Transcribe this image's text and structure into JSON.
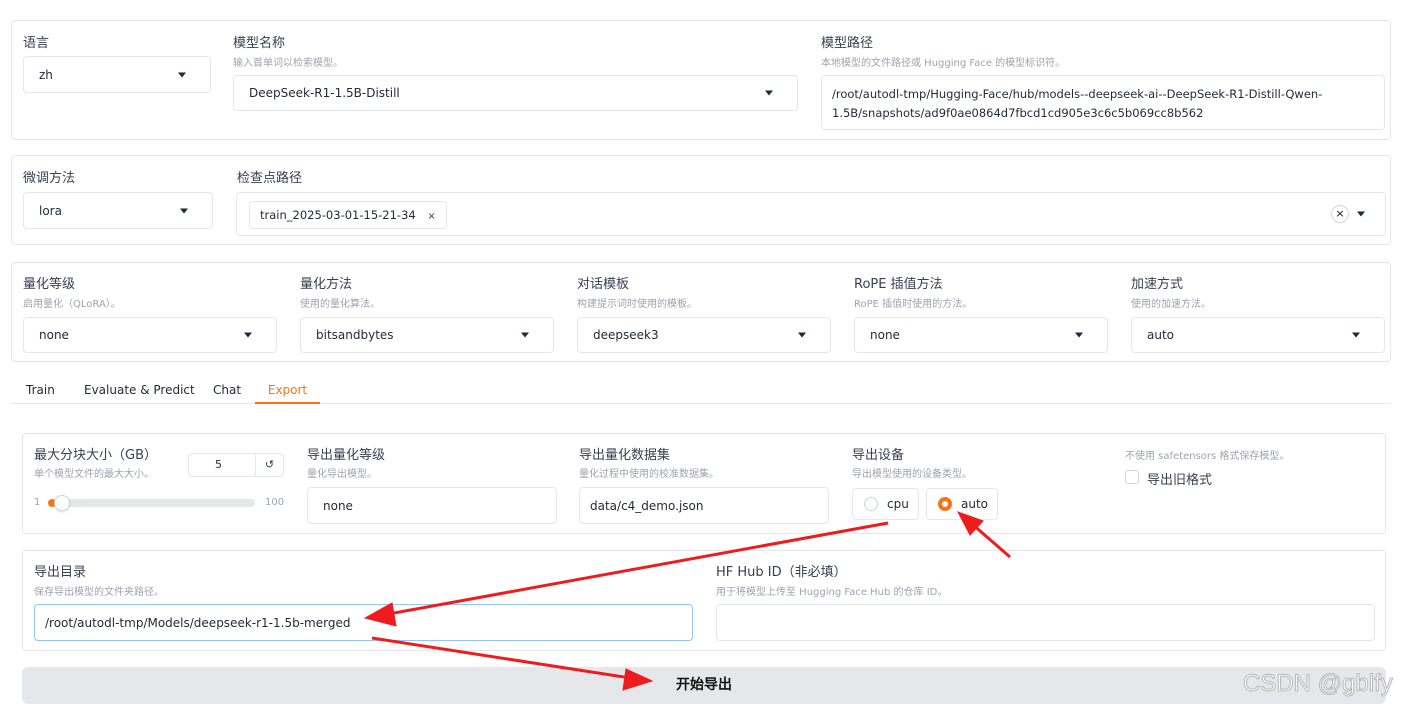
{
  "model_section": {
    "language": {
      "label": "语言",
      "value": "zh"
    },
    "model_name": {
      "label": "模型名称",
      "hint": "输入首单词以检索模型。",
      "value": "DeepSeek-R1-1.5B-Distill"
    },
    "model_path": {
      "label": "模型路径",
      "hint": "本地模型的文件路径或 Hugging Face 的模型标识符。",
      "value_line1": "/root/autodl-tmp/Hugging-Face/hub/models--deepseek-ai--DeepSeek-R1-Distill-Qwen-",
      "value_line2": "1.5B/snapshots/ad9f0ae0864d7fbcd1cd905e3c6c5b069cc8b562"
    }
  },
  "finetune_section": {
    "method": {
      "label": "微调方法",
      "value": "lora"
    },
    "checkpoint": {
      "label": "检查点路径",
      "tag": "train_2025-03-01-15-21-34",
      "tag_close": "×",
      "clear": "×"
    }
  },
  "advanced_section": {
    "quant_bit": {
      "label": "量化等级",
      "hint": "启用量化（QLoRA）。",
      "value": "none"
    },
    "quant_method": {
      "label": "量化方法",
      "hint": "使用的量化算法。",
      "value": "bitsandbytes"
    },
    "template": {
      "label": "对话模板",
      "hint": "构建提示词时使用的模板。",
      "value": "deepseek3"
    },
    "rope": {
      "label": "RoPE 插值方法",
      "hint": "RoPE 插值时使用的方法。",
      "value": "none"
    },
    "booster": {
      "label": "加速方式",
      "hint": "使用的加速方法。",
      "value": "auto"
    }
  },
  "tabs": [
    {
      "label": "Train",
      "active": false
    },
    {
      "label": "Evaluate & Predict",
      "active": false
    },
    {
      "label": "Chat",
      "active": false
    },
    {
      "label": "Export",
      "active": true
    }
  ],
  "export": {
    "shard_size": {
      "label": "最大分块大小（GB）",
      "hint": "单个模型文件的最大大小。",
      "value": "5",
      "reset": "↺",
      "min": "1",
      "max": "100",
      "level": 0.04
    },
    "quant_bit": {
      "label": "导出量化等级",
      "hint": "量化导出模型。",
      "value": "none"
    },
    "quant_dataset": {
      "label": "导出量化数据集",
      "hint": "量化过程中使用的校准数据集。",
      "value": "data/c4_demo.json"
    },
    "device": {
      "label": "导出设备",
      "hint": "导出模型使用的设备类型。",
      "options": [
        "cpu",
        "auto"
      ],
      "selected": "auto"
    },
    "legacy": {
      "hint": "不使用 safetensors 格式保存模型。",
      "label": "导出旧格式",
      "checked": false
    },
    "dir": {
      "label": "导出目录",
      "hint": "保存导出模型的文件夹路径。",
      "value": "/root/autodl-tmp/Models/deepseek-r1-1.5b-merged"
    },
    "hub": {
      "label": "HF Hub ID（非必填）",
      "hint": "用于将模型上传至 Hugging Face Hub 的仓库 ID。",
      "value": ""
    },
    "start_button": "开始导出"
  },
  "watermark": "CSDN @gblfy",
  "colors": {
    "accent": "#f97316",
    "annotation_arrow": "#ee1c1c",
    "button_bg": "#e5e7eb"
  }
}
